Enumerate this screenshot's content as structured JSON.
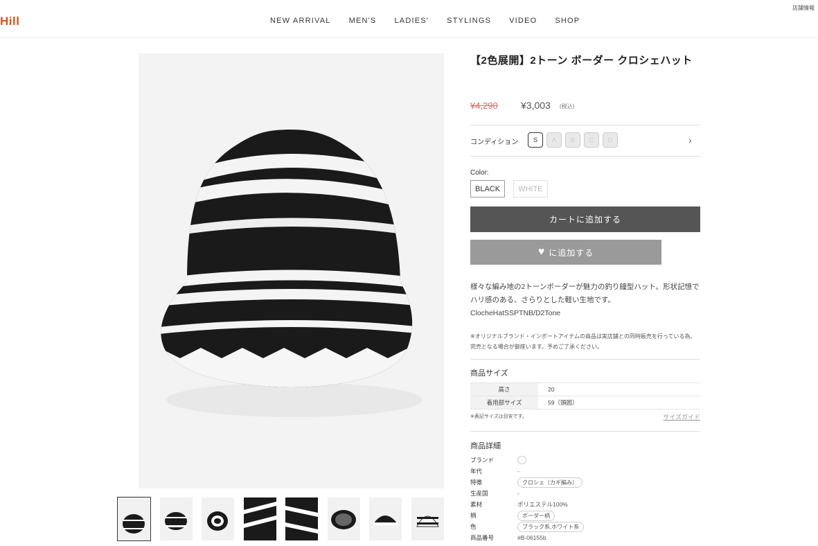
{
  "header": {
    "logo": "Hill",
    "store_link": "店舗情報",
    "nav": [
      "NEW ARRIVAL",
      "MEN'S",
      "LADIES'",
      "STYLINGS",
      "VIDEO",
      "SHOP"
    ]
  },
  "product": {
    "title": "【2色展開】2トーン ボーダー クロシェハット",
    "price_old": "¥4,290",
    "price_new": "¥3,003",
    "tax_label": "(税込)",
    "condition_label": "コンディション",
    "condition_options": [
      "S",
      "A",
      "B",
      "C",
      "D"
    ],
    "condition_selected": "S",
    "color_label": "Color:",
    "colors": [
      "BLACK",
      "WHITE"
    ],
    "color_selected": "BLACK",
    "cart_button": "カートに追加する",
    "fav_button": "に追加する",
    "description": [
      "様々な編み地の2トーンボーダーが魅力の釣り鐘型ハット。形状記憶で",
      "ハリ感のある、さらりとした軽い生地です。",
      "ClocheHatSSPTNB/D2Tone"
    ],
    "note": "※オリジナルブランド・インポートアイテムの商品は実店舗との同時販売を行っている為、完売となる場合が御座います。予めご了承ください。"
  },
  "size": {
    "title": "商品サイズ",
    "rows": [
      {
        "k": "高さ",
        "v": "20"
      },
      {
        "k": "着用部サイズ",
        "v": "59（頭囲）"
      }
    ],
    "note": "※表記サイズは目安です。",
    "guide": "サイズガイド"
  },
  "details": {
    "title": "商品詳細",
    "rows": [
      {
        "k": "ブランド",
        "v": "",
        "tag": true
      },
      {
        "k": "年代",
        "v": "-"
      },
      {
        "k": "特徴",
        "v": "クロシェ（カギ編み）",
        "tag": true
      },
      {
        "k": "生産国",
        "v": "-"
      },
      {
        "k": "素材",
        "v": "ポリエステル100%"
      },
      {
        "k": "柄",
        "v": "ボーダー柄",
        "tag": true
      },
      {
        "k": "色",
        "v": "ブラック系,ホワイト系",
        "tag": true
      },
      {
        "k": "商品番号",
        "v": "#B-06155b"
      }
    ]
  },
  "colors": {
    "accent": "#d9531e",
    "cart_button": "#555555",
    "fav_button": "#9a9a9a",
    "old_price": "#e06666"
  },
  "thumb_count": 8
}
